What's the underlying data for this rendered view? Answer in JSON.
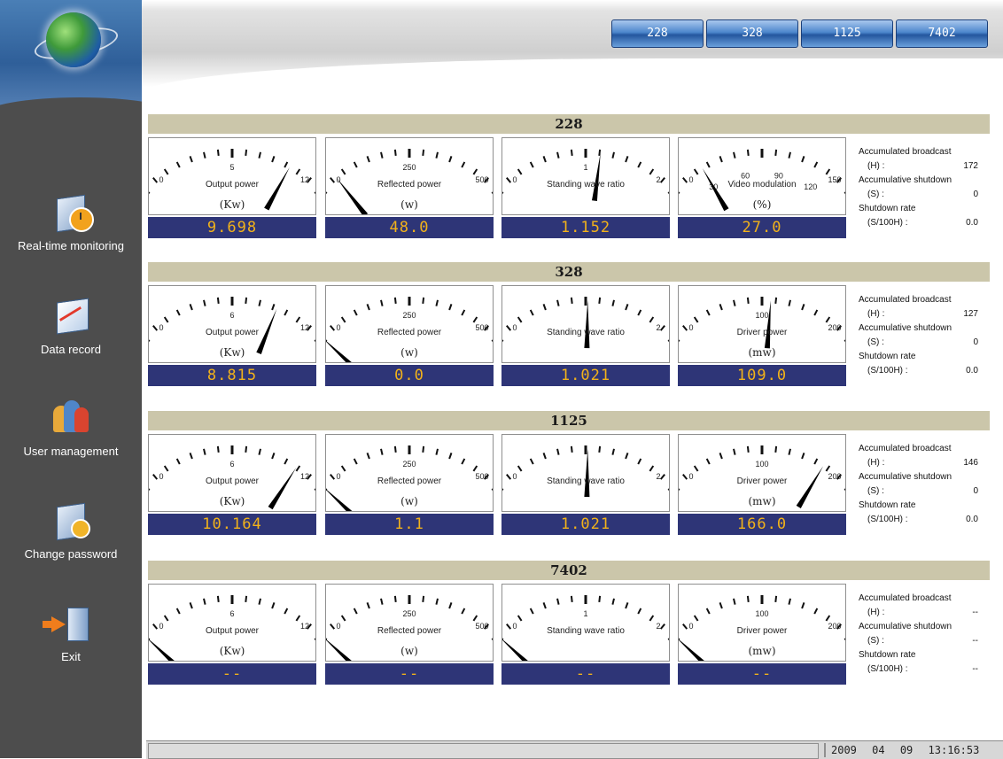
{
  "sidebar": {
    "items": [
      {
        "label": "Real-time monitoring"
      },
      {
        "label": "Data record"
      },
      {
        "label": "User management"
      },
      {
        "label": "Change password"
      },
      {
        "label": "Exit"
      }
    ]
  },
  "header": {
    "tabs": [
      {
        "label": "228"
      },
      {
        "label": "328"
      },
      {
        "label": "1125"
      },
      {
        "label": "7402"
      }
    ]
  },
  "stats_labels": {
    "broadcast": "Accumulated broadcast",
    "broadcast_unit": "(H) :",
    "shutdown": "Accumulative shutdown",
    "shutdown_unit": "(S) :",
    "rate": "Shutdown rate",
    "rate_unit": "(S/100H) :"
  },
  "transmitters": [
    {
      "name": "228",
      "gauges": [
        {
          "label": "Output power",
          "unit": "(Kw)",
          "max": 12,
          "mid": "5",
          "value": 9.698,
          "display": "9.698"
        },
        {
          "label": "Reflected power",
          "unit": "(w)",
          "max": 500,
          "mid": "250",
          "value": 48.0,
          "display": "48.0"
        },
        {
          "label": "Standing wave ratio",
          "unit": "",
          "max": 2,
          "mid": "1",
          "value": 1.152,
          "display": "1.152"
        },
        {
          "label": "Video modulation",
          "unit": "(%)",
          "max": 150,
          "mid": "",
          "ticks": [
            "30",
            "60",
            "90",
            "120"
          ],
          "value": 27.0,
          "display": "27.0"
        }
      ],
      "stats": {
        "broadcast": "172",
        "shutdown": "0",
        "rate": "0.0"
      }
    },
    {
      "name": "328",
      "gauges": [
        {
          "label": "Output power",
          "unit": "(Kw)",
          "max": 12,
          "mid": "6",
          "value": 8.815,
          "display": "8.815"
        },
        {
          "label": "Reflected power",
          "unit": "(w)",
          "max": 500,
          "mid": "250",
          "value": 0.0,
          "display": "0.0"
        },
        {
          "label": "Standing wave ratio",
          "unit": "",
          "max": 2,
          "mid": "",
          "value": 1.021,
          "display": "1.021"
        },
        {
          "label": "Driver power",
          "unit": "(mw)",
          "max": 200,
          "mid": "100",
          "value": 109.0,
          "display": "109.0"
        }
      ],
      "stats": {
        "broadcast": "127",
        "shutdown": "0",
        "rate": "0.0"
      }
    },
    {
      "name": "1125",
      "gauges": [
        {
          "label": "Output power",
          "unit": "(Kw)",
          "max": 12,
          "mid": "6",
          "value": 10.164,
          "display": "10.164"
        },
        {
          "label": "Reflected power",
          "unit": "(w)",
          "max": 500,
          "mid": "250",
          "value": 1.1,
          "display": "1.1"
        },
        {
          "label": "Standing wave ratio",
          "unit": "",
          "max": 2,
          "mid": "",
          "value": 1.021,
          "display": "1.021"
        },
        {
          "label": "Driver power",
          "unit": "(mw)",
          "max": 200,
          "mid": "100",
          "value": 166.0,
          "display": "166.0"
        }
      ],
      "stats": {
        "broadcast": "146",
        "shutdown": "0",
        "rate": "0.0"
      }
    },
    {
      "name": "7402",
      "gauges": [
        {
          "label": "Output power",
          "unit": "(Kw)",
          "max": 12,
          "mid": "6",
          "value": 0,
          "display": "--"
        },
        {
          "label": "Reflected power",
          "unit": "(w)",
          "max": 500,
          "mid": "250",
          "value": 0,
          "display": "--"
        },
        {
          "label": "Standing wave ratio",
          "unit": "",
          "max": 2,
          "mid": "1",
          "value": 0,
          "display": "--"
        },
        {
          "label": "Driver power",
          "unit": "(mw)",
          "max": 200,
          "mid": "100",
          "value": 0,
          "display": "--"
        }
      ],
      "stats": {
        "broadcast": "--",
        "shutdown": "--",
        "rate": "--"
      }
    }
  ],
  "status": {
    "year": "2009",
    "month": "04",
    "day": "09",
    "time": "13:16:53"
  },
  "colors": {
    "sidebar_bg": "#4d4d4d",
    "section_bar": "#cbc6aa",
    "readout_bg": "#2e3577",
    "readout_text": "#f2b21a",
    "tab_blue": "#24569e"
  }
}
